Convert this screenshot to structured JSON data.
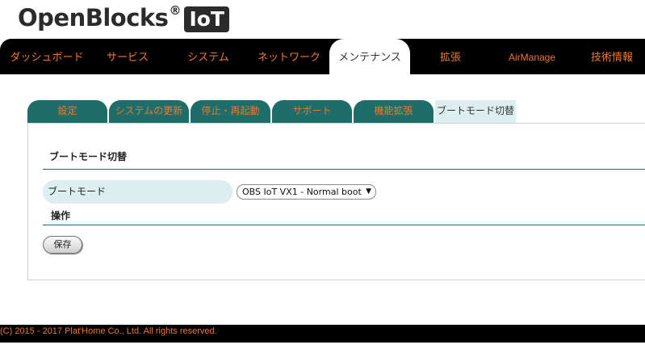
{
  "logo": {
    "text": "OpenBlocks",
    "reg": "®",
    "badge": "IoT"
  },
  "nav": {
    "items": [
      {
        "label": "ダッシュボード"
      },
      {
        "label": "サービス"
      },
      {
        "label": "システム"
      },
      {
        "label": "ネットワーク"
      },
      {
        "label": "メンテナンス",
        "active": true
      },
      {
        "label": "拡張"
      },
      {
        "label": "AirManage"
      },
      {
        "label": "技術情報"
      }
    ]
  },
  "subtabs": {
    "items": [
      {
        "label": "設定"
      },
      {
        "label": "システムの更新"
      },
      {
        "label": "停止・再起動"
      },
      {
        "label": "サポート"
      },
      {
        "label": "機能拡張"
      },
      {
        "label": "ブートモード切替",
        "active": true
      }
    ]
  },
  "main": {
    "section_title": "ブートモード切替",
    "boot_mode_label": "ブートモード",
    "boot_mode_value": "OBS IoT VX1 - Normal boot",
    "operation_title": "操作",
    "save_label": "保存"
  },
  "footer": {
    "text": "(C) 2015 - 2017 Plat'Home Co., Ltd. All rights reserved."
  },
  "colors": {
    "accent": "#f0782a",
    "teal": "#1d6d6b",
    "light_teal": "#dceeee",
    "bar": "#000000"
  },
  "icons": {
    "select_arrow": "triangle-down-icon"
  }
}
